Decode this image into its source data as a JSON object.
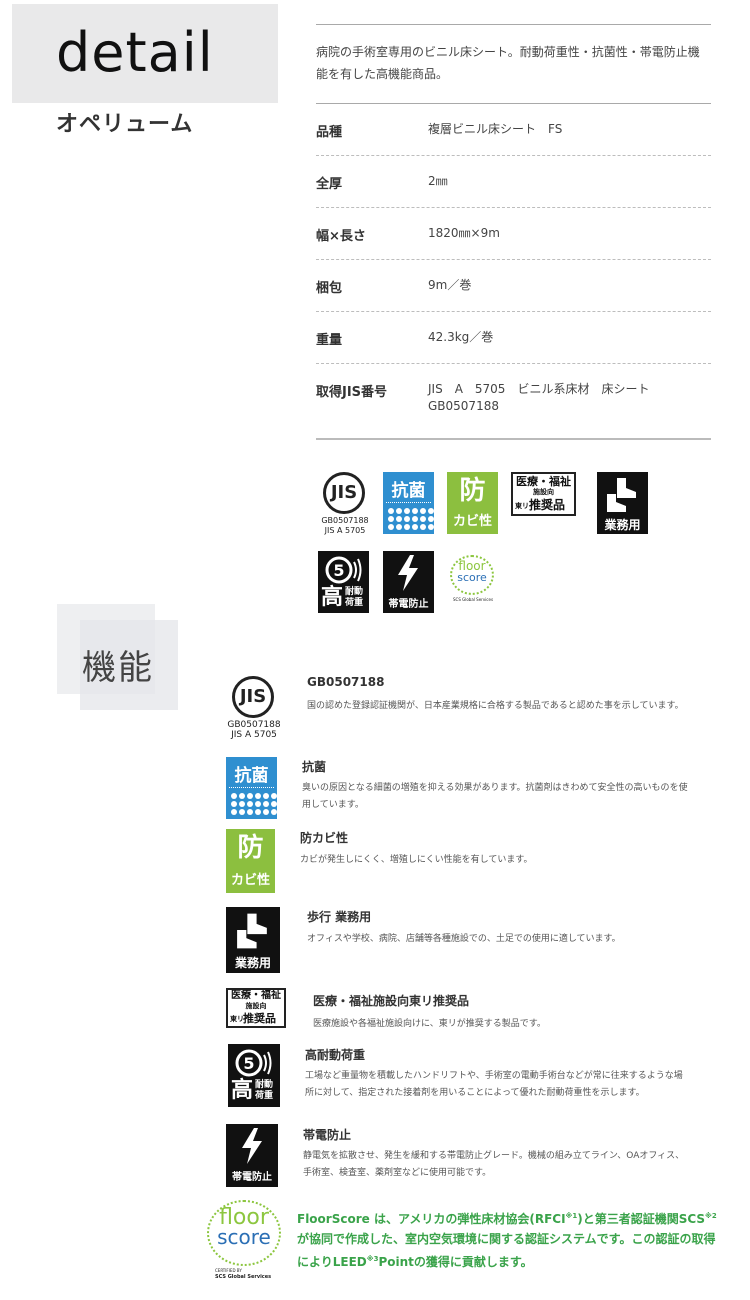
{
  "header": {
    "section_word": "detail",
    "product_name": "オペリューム"
  },
  "spec": {
    "description": "病院の手術室専用のビニル床シート。耐動荷重性・抗菌性・帯電防止機能を有した高機能商品。",
    "rows": [
      {
        "label": "品種",
        "value": "複層ビニル床シート　FS"
      },
      {
        "label": "全厚",
        "value": "2㎜"
      },
      {
        "label": "幅×長さ",
        "value": "1820㎜×9m"
      },
      {
        "label": "梱包",
        "value": "9m／巻"
      },
      {
        "label": "重量",
        "value": "42.3kg／巻"
      },
      {
        "label": "取得JIS番号",
        "value": "JIS　A　5705　ビニル系床材　床シート",
        "value2": "GB0507188"
      }
    ]
  },
  "icons": {
    "jis_mark": "JIS",
    "jis_code1": "GB0507188",
    "jis_code2": "JIS A 5705",
    "kokin": "抗菌",
    "bokabi_big": "防",
    "bokabi_small": "カビ性",
    "iryo_line1": "医療・福祉",
    "iryo_line2": "施設向",
    "iryo_line3a": "東リ",
    "iryo_line3b": "推奨品",
    "gyomu": "業務用",
    "kotaido_big": "高",
    "kotaido_small1": "耐動",
    "kotaido_small2": "荷重",
    "taiden": "帯電防止",
    "floor": "floor",
    "score": "score",
    "certified": "CERTIFIED BY",
    "scs": "SCS Global Services"
  },
  "kinou": {
    "heading": "機能",
    "items": [
      {
        "title": "GB0507188",
        "desc": "国の認めた登録認証機関が、日本産業規格に合格する製品であると認めた事を示しています。"
      },
      {
        "title": "抗菌",
        "desc": "臭いの原因となる細菌の増殖を抑える効果があります。抗菌剤はきわめて安全性の高いものを使用しています。"
      },
      {
        "title": "防カビ性",
        "desc": "カビが発生しにくく、増殖しにくい性能を有しています。"
      },
      {
        "title": "歩行 業務用",
        "desc": "オフィスや学校、病院、店舗等各種施設での、土足での使用に適しています。"
      },
      {
        "title": "医療・福祉施設向東リ推奨品",
        "desc": "医療施設や各福祉施設向けに、東リが推奨する製品です。"
      },
      {
        "title": "高耐動荷重",
        "desc": "工場など重量物を積載したハンドリフトや、手術室の電動手術台などが常に往来するような場所に対して、指定された接着剤を用いることによって優れた耐動荷重性を示します。"
      },
      {
        "title": "帯電防止",
        "desc": "静電気を拡散させ、発生を緩和する帯電防止グレード。機械の組み立てライン、OAオフィス、手術室、検査室、薬剤室などに使用可能です。"
      }
    ],
    "floorscore": {
      "part1": "FloorScore は、アメリカの弾性床材協会(RFCI",
      "sup1": "※1",
      "part2": ")と第三者認証機関SCS",
      "sup2": "※2",
      "part3": "が協同で作成した、室内空気環境に関する認証システムです。この認証の取得によりLEED",
      "sup3": "※3",
      "part4": "Pointの獲得に貢献します。"
    }
  },
  "colors": {
    "kokin_blue": "#2f8fd0",
    "bokabi_green": "#8cbf3f",
    "floorscore_green": "#3aa34a",
    "floorscore_blue": "#2b6fb5"
  }
}
